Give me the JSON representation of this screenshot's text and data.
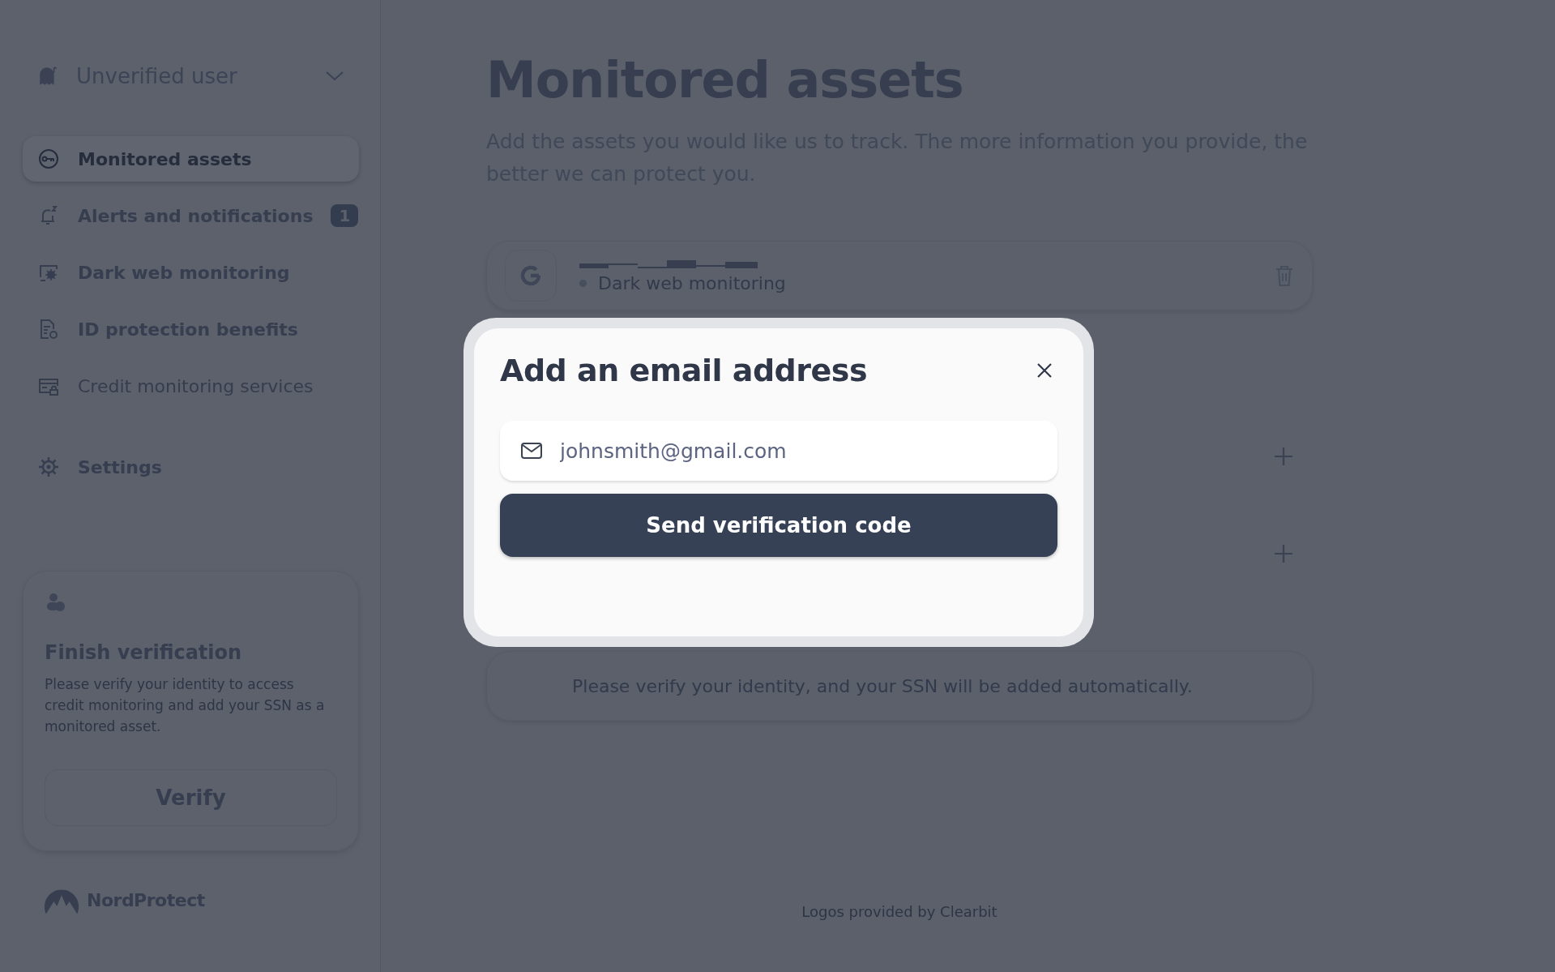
{
  "sidebar": {
    "user": {
      "label": "Unverified user"
    },
    "items": [
      {
        "kind": "key",
        "label": "Monitored assets",
        "selected": true,
        "disabled": false
      },
      {
        "kind": "bell",
        "label": "Alerts and notifications",
        "selected": false,
        "disabled": false,
        "badge": "1"
      },
      {
        "kind": "web",
        "label": "Dark web monitoring",
        "selected": false,
        "disabled": false
      },
      {
        "kind": "doc",
        "label": "ID protection benefits",
        "selected": false,
        "disabled": false
      },
      {
        "kind": "card",
        "label": "Credit monitoring services",
        "selected": false,
        "disabled": true
      },
      {
        "kind": "gear",
        "label": "Settings",
        "selected": false,
        "disabled": false
      }
    ],
    "verification": {
      "title": "Finish verification",
      "text": "Please verify your identity to access credit monitoring and add your SSN as a monitored asset.",
      "button": "Verify"
    },
    "brand": "NordProtect"
  },
  "main": {
    "title": "Monitored assets",
    "description": "Add the assets you would like us to track. The more information you provide, the better we can protect you.",
    "assets": [
      {
        "kind": "asset",
        "status": "Dark web monitoring"
      },
      {
        "kind": "add"
      },
      {
        "kind": "add"
      },
      {
        "kind": "notice",
        "text": "Please verify your identity, and your SSN will be added automatically."
      }
    ],
    "footer": "Logos provided by Clearbit"
  },
  "modal": {
    "title": "Add an email address",
    "email": {
      "value": "johnsmith@gmail.com"
    },
    "button": "Send verification code"
  }
}
